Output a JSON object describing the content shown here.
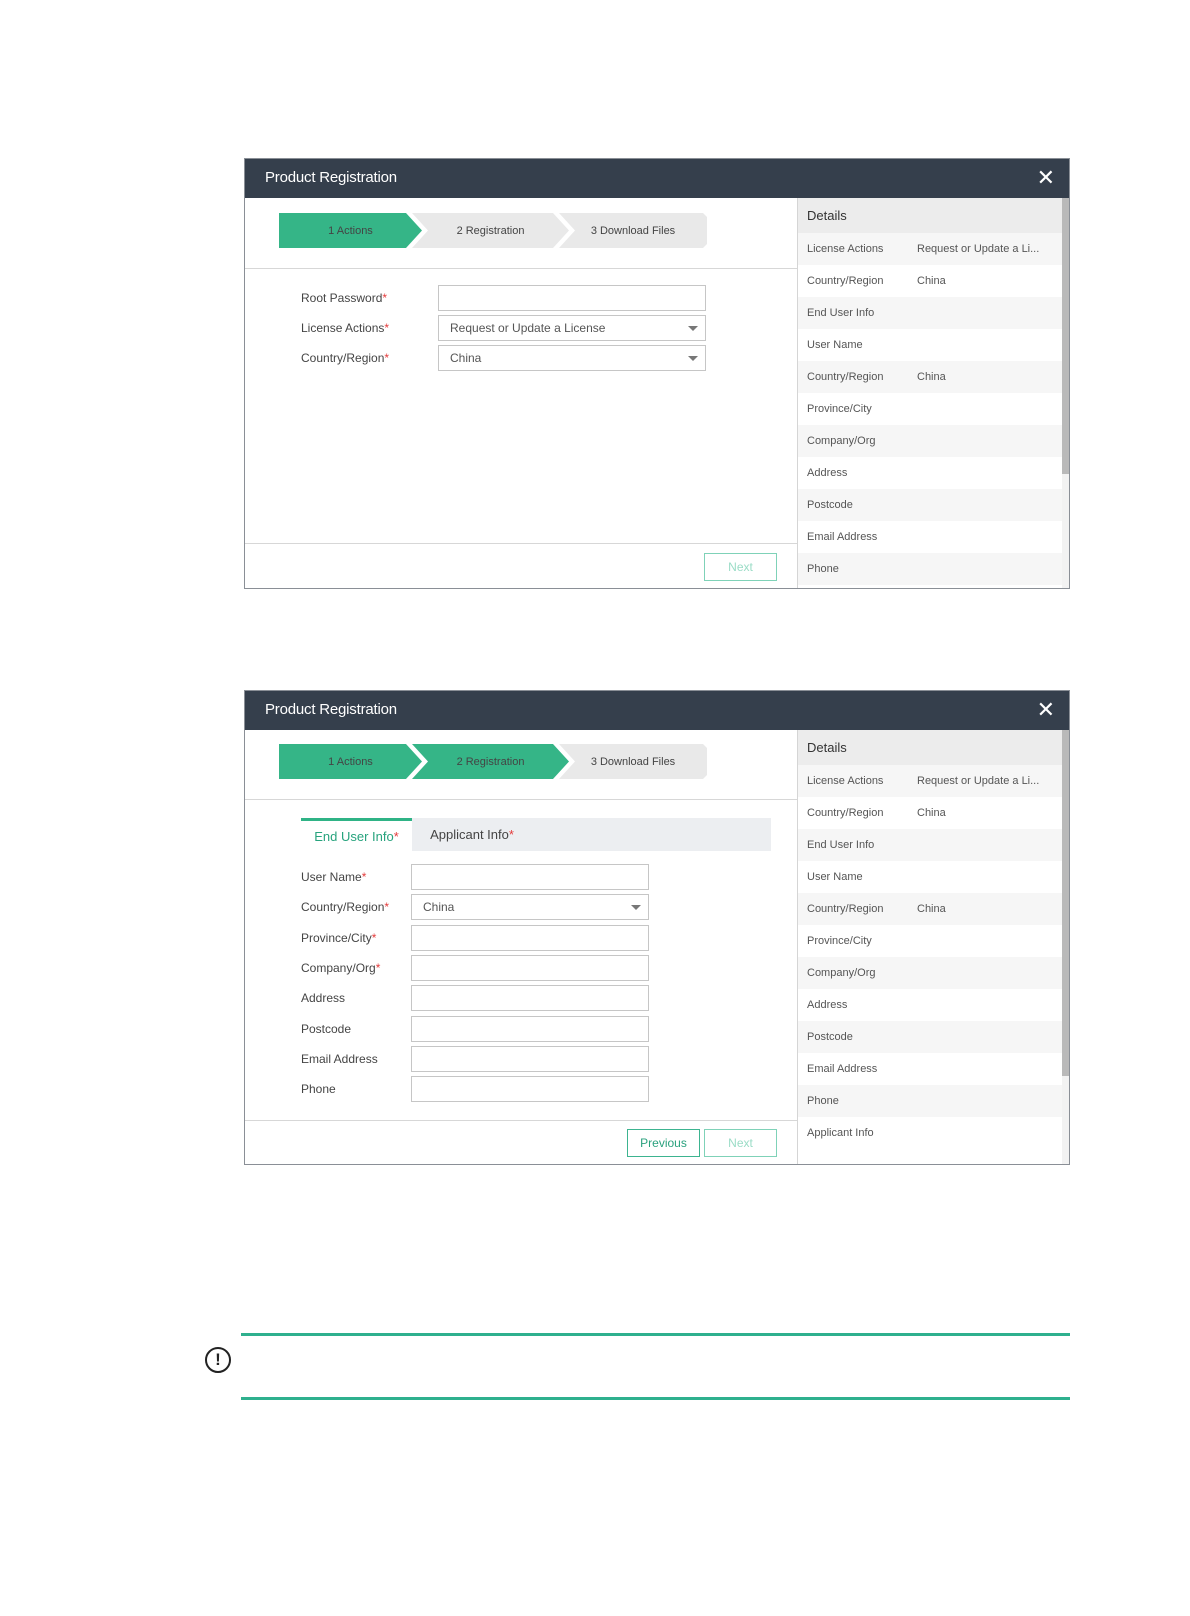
{
  "dialog1": {
    "title": "Product Registration",
    "close_glyph": "✕",
    "steps": [
      {
        "label": "1 Actions",
        "state": "active"
      },
      {
        "label": "2 Registration",
        "state": "inactive"
      },
      {
        "label": "3 Download Files",
        "state": "inactive"
      }
    ],
    "fields": [
      {
        "label": "Root Password",
        "required": "*",
        "value": ""
      },
      {
        "label": "License Actions",
        "required": "*",
        "value": "Request or Update a License"
      },
      {
        "label": "Country/Region",
        "required": "*",
        "value": "China"
      }
    ],
    "next_label": "Next",
    "details": {
      "header": "Details",
      "rows": [
        {
          "k": "License Actions",
          "v": "Request or Update a Li..."
        },
        {
          "k": "Country/Region",
          "v": "China"
        },
        {
          "k": "End User Info",
          "v": ""
        },
        {
          "k": "User Name",
          "v": ""
        },
        {
          "k": "Country/Region",
          "v": "China"
        },
        {
          "k": "Province/City",
          "v": ""
        },
        {
          "k": "Company/Org",
          "v": ""
        },
        {
          "k": "Address",
          "v": ""
        },
        {
          "k": "Postcode",
          "v": ""
        },
        {
          "k": "Email Address",
          "v": ""
        },
        {
          "k": "Phone",
          "v": ""
        }
      ]
    }
  },
  "dialog2": {
    "title": "Product Registration",
    "close_glyph": "✕",
    "steps": [
      {
        "label": "1 Actions",
        "state": "active"
      },
      {
        "label": "2 Registration",
        "state": "active"
      },
      {
        "label": "3 Download Files",
        "state": "inactive"
      }
    ],
    "tabs": [
      {
        "label": "End User Info",
        "required": "*"
      },
      {
        "label": "Applicant Info",
        "required": "*"
      }
    ],
    "fields": [
      {
        "label": "User Name",
        "required": "*",
        "value": ""
      },
      {
        "label": "Country/Region",
        "required": "*",
        "value": "China"
      },
      {
        "label": "Province/City",
        "required": "*",
        "value": ""
      },
      {
        "label": "Company/Org",
        "required": "*",
        "value": ""
      },
      {
        "label": "Address",
        "required": "",
        "value": ""
      },
      {
        "label": "Postcode",
        "required": "",
        "value": ""
      },
      {
        "label": "Email Address",
        "required": "",
        "value": ""
      },
      {
        "label": "Phone",
        "required": "",
        "value": ""
      }
    ],
    "previous_label": "Previous",
    "next_label": "Next",
    "details": {
      "header": "Details",
      "rows": [
        {
          "k": "License Actions",
          "v": "Request or Update a Li..."
        },
        {
          "k": "Country/Region",
          "v": "China"
        },
        {
          "k": "End User Info",
          "v": ""
        },
        {
          "k": "User Name",
          "v": ""
        },
        {
          "k": "Country/Region",
          "v": "China"
        },
        {
          "k": "Province/City",
          "v": ""
        },
        {
          "k": "Company/Org",
          "v": ""
        },
        {
          "k": "Address",
          "v": ""
        },
        {
          "k": "Postcode",
          "v": ""
        },
        {
          "k": "Email Address",
          "v": ""
        },
        {
          "k": "Phone",
          "v": ""
        },
        {
          "k": "Applicant Info",
          "v": ""
        }
      ]
    }
  },
  "notice": {
    "icon": "exclamation-circle-icon",
    "glyph": "!"
  },
  "colors": {
    "accent": "#35b587",
    "titlebar": "#353f4c",
    "step_inactive": "#e9e9e9"
  }
}
